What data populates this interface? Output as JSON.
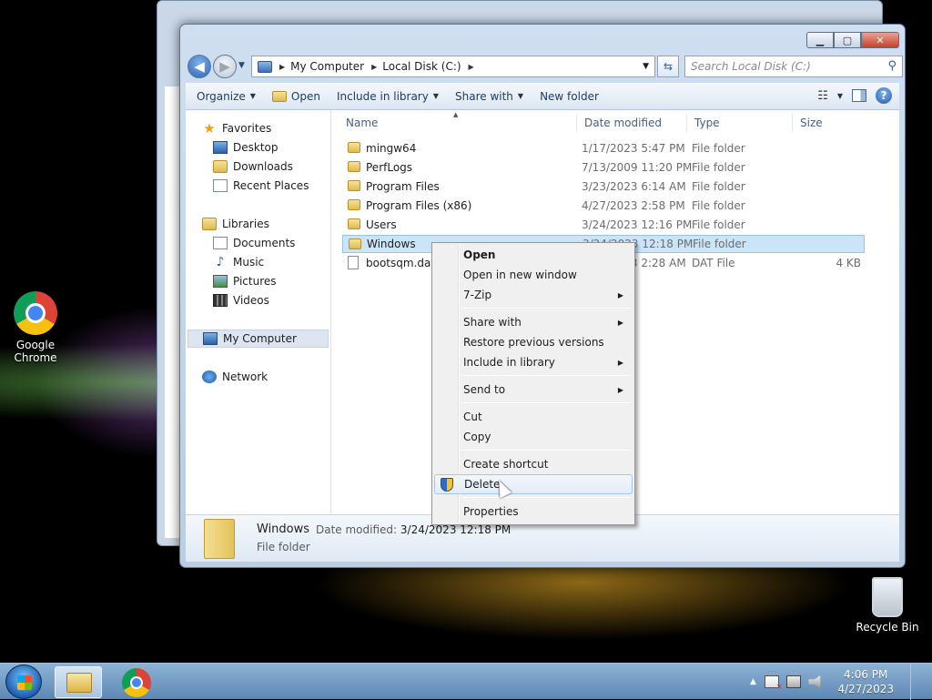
{
  "desktop": {
    "icons": [
      {
        "label_line1": "Google",
        "label_line2": "Chrome"
      },
      {
        "label_line1": "Recycle Bin",
        "label_line2": ""
      }
    ]
  },
  "window": {
    "address": {
      "crumbs": [
        "My Computer",
        "Local Disk (C:)"
      ]
    },
    "search_placeholder": "Search Local Disk (C:)",
    "toolbar": {
      "organize": "Organize",
      "open": "Open",
      "include_in_library": "Include in library",
      "share_with": "Share with",
      "new_folder": "New folder"
    },
    "nav": {
      "favorites": "Favorites",
      "desktop": "Desktop",
      "downloads": "Downloads",
      "recent_places": "Recent Places",
      "libraries": "Libraries",
      "documents": "Documents",
      "music": "Music",
      "pictures": "Pictures",
      "videos": "Videos",
      "my_computer": "My Computer",
      "network": "Network"
    },
    "columns": {
      "name": "Name",
      "date": "Date modified",
      "type": "Type",
      "size": "Size"
    },
    "files": [
      {
        "name": "mingw64",
        "date": "1/17/2023 5:47 PM",
        "type": "File folder",
        "size": ""
      },
      {
        "name": "PerfLogs",
        "date": "7/13/2009 11:20 PM",
        "type": "File folder",
        "size": ""
      },
      {
        "name": "Program Files",
        "date": "3/23/2023 6:14 AM",
        "type": "File folder",
        "size": ""
      },
      {
        "name": "Program Files (x86)",
        "date": "4/27/2023 2:58 PM",
        "type": "File folder",
        "size": ""
      },
      {
        "name": "Users",
        "date": "3/24/2023 12:16 PM",
        "type": "File folder",
        "size": ""
      },
      {
        "name": "Windows",
        "date": "3/24/2023 12:18 PM",
        "type": "File folder",
        "size": ""
      },
      {
        "name": "bootsqm.dat",
        "date": "4/27/2023 2:28 AM",
        "type": "DAT File",
        "size": "4 KB"
      }
    ],
    "details": {
      "name": "Windows",
      "date_label": "Date modified:",
      "date_value": "3/24/2023 12:18 PM",
      "type": "File folder"
    }
  },
  "context_menu": {
    "open": "Open",
    "open_new_window": "Open in new window",
    "seven_zip": "7-Zip",
    "share_with": "Share with",
    "restore_previous": "Restore previous versions",
    "include_in_library": "Include in library",
    "send_to": "Send to",
    "cut": "Cut",
    "copy": "Copy",
    "create_shortcut": "Create shortcut",
    "delete": "Delete",
    "properties": "Properties"
  },
  "taskbar": {
    "clock_time": "4:06 PM",
    "clock_date": "4/27/2023"
  }
}
